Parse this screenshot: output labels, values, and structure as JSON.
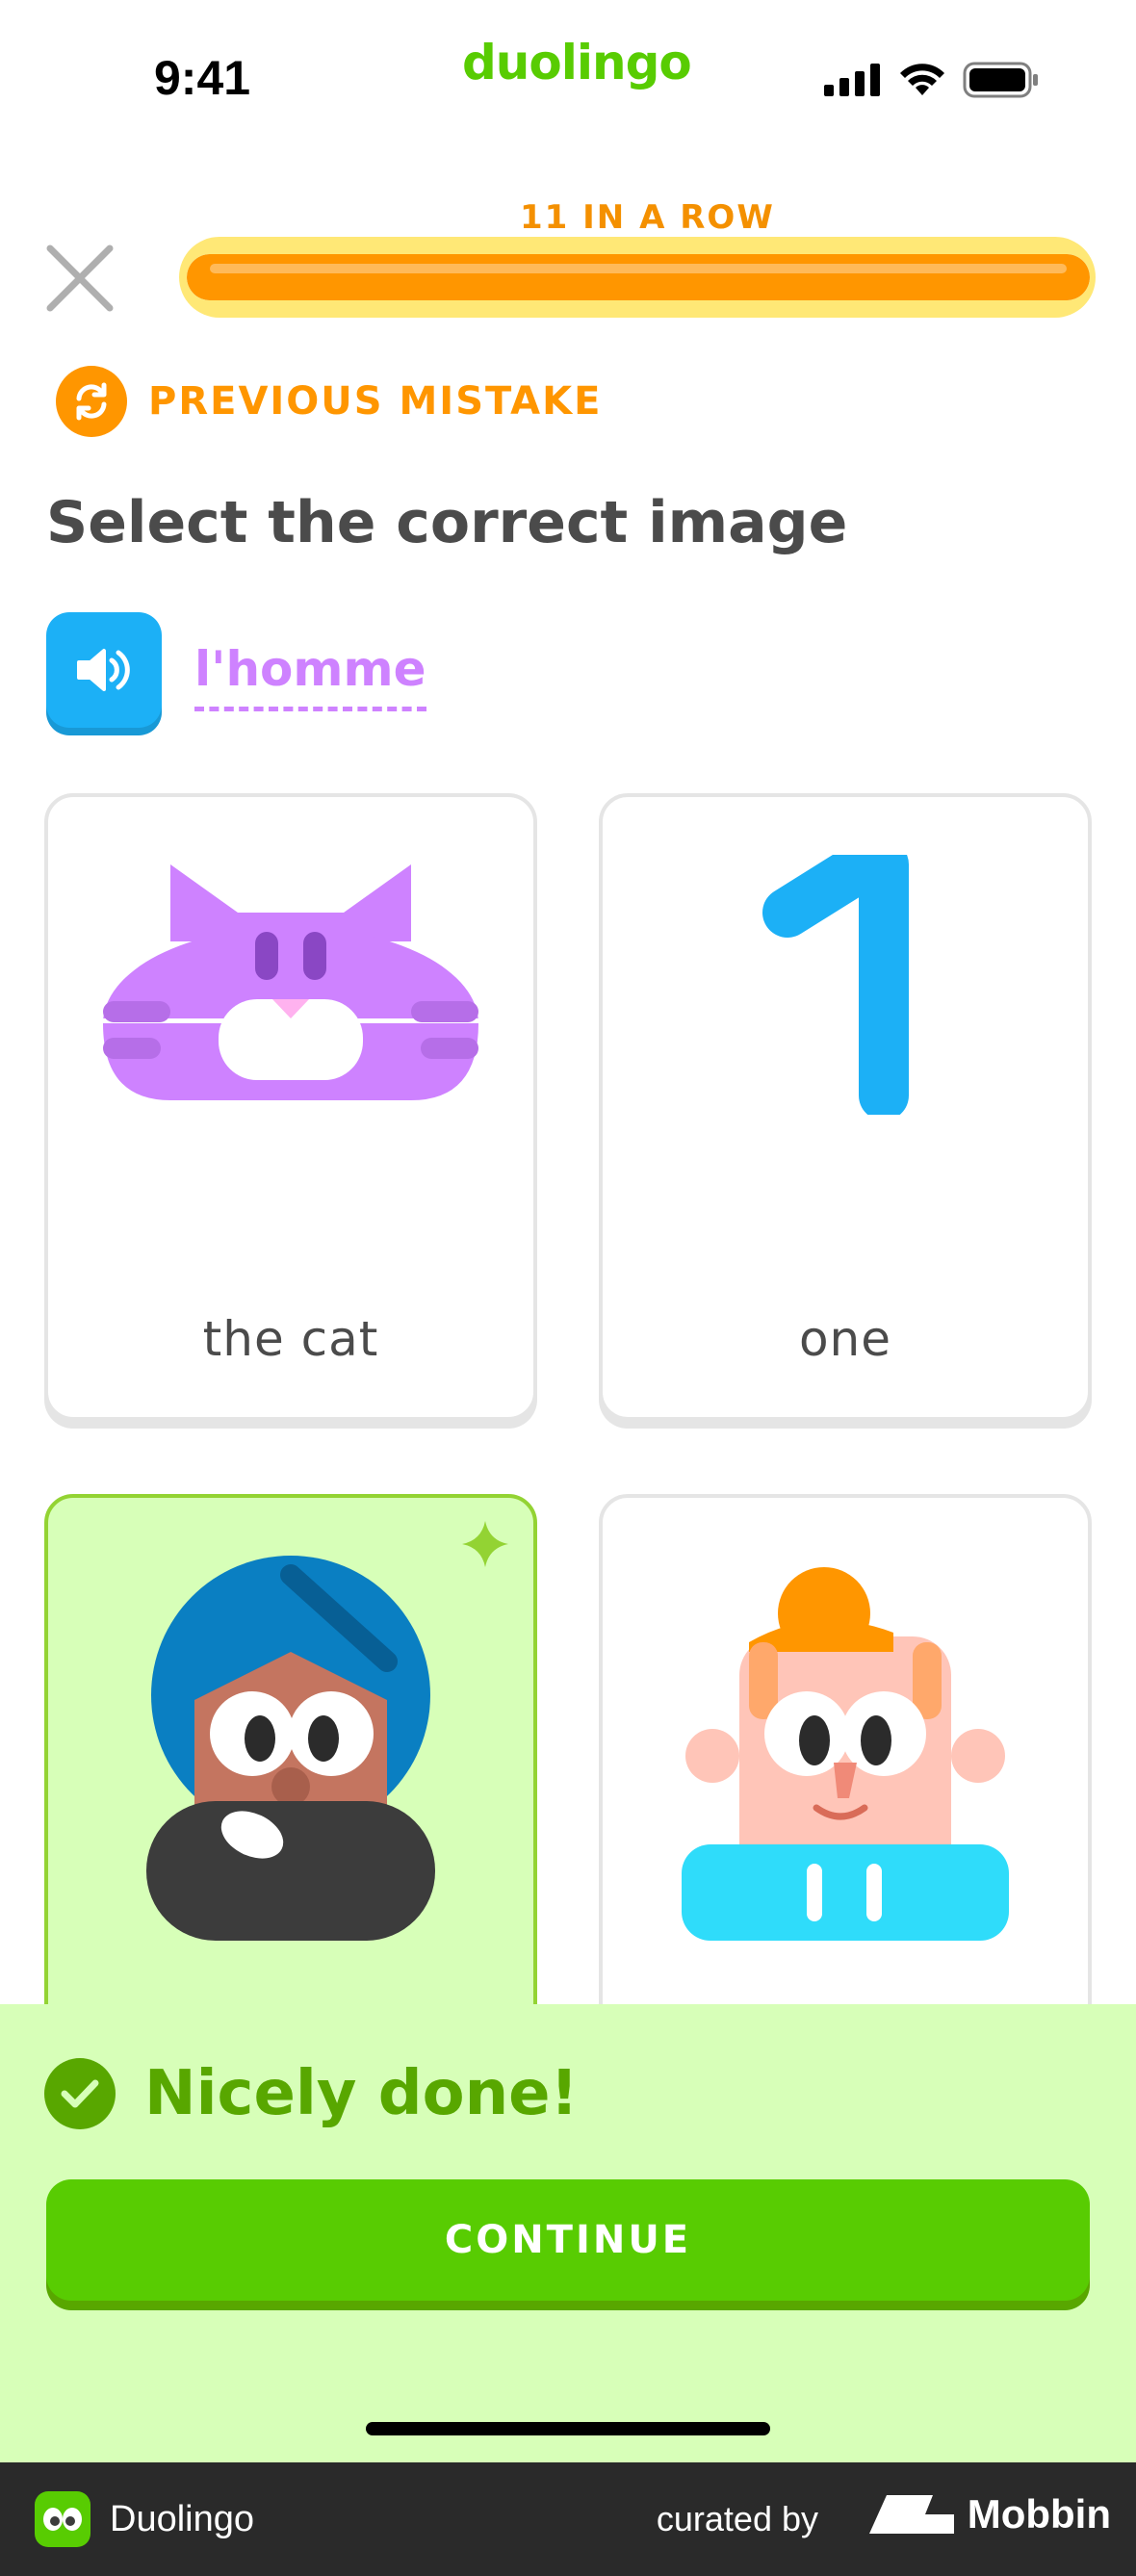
{
  "status_bar": {
    "time": "9:41",
    "brand": "duolingo"
  },
  "lesson": {
    "streak_label": "11 IN A ROW",
    "progress_fraction": 1.0,
    "mistake_label": "PREVIOUS MISTAKE",
    "prompt": "Select the correct image",
    "target_word": "l'homme"
  },
  "cards": [
    {
      "label": "the cat",
      "selected": false
    },
    {
      "label": "one",
      "selected": false
    },
    {
      "label": "",
      "selected": true
    },
    {
      "label": "",
      "selected": false
    }
  ],
  "feedback": {
    "message": "Nicely done!",
    "continue_label": "CONTINUE"
  },
  "footer": {
    "app_name": "Duolingo",
    "curated_by": "curated by",
    "mobbin": "Mobbin"
  },
  "colors": {
    "brand_green": "#58cc02",
    "streak_orange": "#ff9600",
    "word_purple": "#ce82ff",
    "speaker_blue": "#1cb0f6",
    "success_bg": "#d7ffb8"
  },
  "icons": [
    "close-icon",
    "repeat-icon",
    "speaker-icon",
    "check-icon",
    "signal-icon",
    "wifi-icon",
    "battery-icon",
    "sparkle-icon"
  ]
}
